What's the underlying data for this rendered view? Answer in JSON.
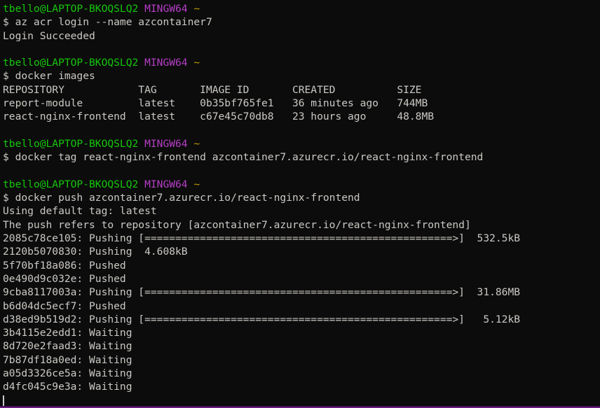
{
  "terminal": {
    "shell": "MINGW64",
    "colors": {
      "background": "#0c0c0c",
      "foreground": "#ccc9c5",
      "user_host": "#16c60c",
      "shell_label": "#b53ec6",
      "cwd": "#c19c00",
      "border": "#6a1b82"
    },
    "prompt": {
      "user_host": "tbello@LAPTOP-BKOQSLQ2",
      "shell_label": "MINGW64",
      "cwd": "~"
    },
    "blocks": [
      {
        "command": "$ az acr login --name azcontainer7",
        "output": [
          "Login Succeeded"
        ]
      },
      {
        "command": "$ docker images",
        "output": [
          "REPOSITORY            TAG       IMAGE ID       CREATED          SIZE",
          "report-module         latest    0b35bf765fe1   36 minutes ago   744MB",
          "react-nginx-frontend  latest    c67e45c70db8   23 hours ago     48.8MB"
        ]
      },
      {
        "command": "$ docker tag react-nginx-frontend azcontainer7.azurecr.io/react-nginx-frontend",
        "output": []
      },
      {
        "command": "$ docker push azcontainer7.azurecr.io/react-nginx-frontend",
        "output": [
          "Using default tag: latest",
          "The push refers to repository [azcontainer7.azurecr.io/react-nginx-frontend]",
          "2085c78ce105: Pushing [==================================================>]  532.5kB",
          "2120b5070830: Pushing  4.608kB",
          "5f70bf18a086: Pushed",
          "0e490d9c032e: Pushed",
          "9cba8117003a: Pushing [==================================================>]  31.86MB",
          "b6d04dc5ecf7: Pushed",
          "d38ed9b519d2: Pushing [==================================================>]   5.12kB",
          "3b4115e2edd1: Waiting",
          "8d720e2faad3: Waiting",
          "7b87df18a0ed: Waiting",
          "a05d3326ce5a: Waiting",
          "d4fc045c9e3a: Waiting"
        ]
      }
    ],
    "docker_images_table": {
      "headers": [
        "REPOSITORY",
        "TAG",
        "IMAGE ID",
        "CREATED",
        "SIZE"
      ],
      "rows": [
        [
          "report-module",
          "latest",
          "0b35bf765fe1",
          "36 minutes ago",
          "744MB"
        ],
        [
          "react-nginx-frontend",
          "latest",
          "c67e45c70db8",
          "23 hours ago",
          "48.8MB"
        ]
      ]
    },
    "push_layers": [
      {
        "id": "2085c78ce105",
        "status": "Pushing",
        "progress": 100,
        "size": "532.5kB"
      },
      {
        "id": "2120b5070830",
        "status": "Pushing",
        "progress": null,
        "size": "4.608kB"
      },
      {
        "id": "5f70bf18a086",
        "status": "Pushed",
        "progress": null,
        "size": ""
      },
      {
        "id": "0e490d9c032e",
        "status": "Pushed",
        "progress": null,
        "size": ""
      },
      {
        "id": "9cba8117003a",
        "status": "Pushing",
        "progress": 100,
        "size": "31.86MB"
      },
      {
        "id": "b6d04dc5ecf7",
        "status": "Pushed",
        "progress": null,
        "size": ""
      },
      {
        "id": "d38ed9b519d2",
        "status": "Pushing",
        "progress": 100,
        "size": "5.12kB"
      },
      {
        "id": "3b4115e2edd1",
        "status": "Waiting",
        "progress": null,
        "size": ""
      },
      {
        "id": "8d720e2faad3",
        "status": "Waiting",
        "progress": null,
        "size": ""
      },
      {
        "id": "7b87df18a0ed",
        "status": "Waiting",
        "progress": null,
        "size": ""
      },
      {
        "id": "a05d3326ce5a",
        "status": "Waiting",
        "progress": null,
        "size": ""
      },
      {
        "id": "d4fc045c9e3a",
        "status": "Waiting",
        "progress": null,
        "size": ""
      }
    ]
  }
}
